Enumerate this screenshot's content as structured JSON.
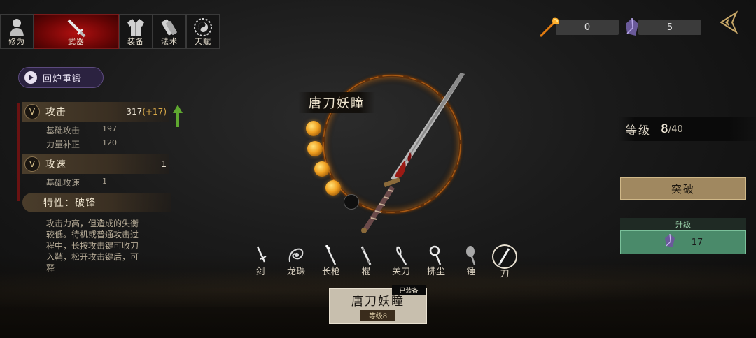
{
  "tabs": [
    {
      "label": "修为",
      "icon": "bust-icon"
    },
    {
      "label": "武器",
      "icon": "sword-icon"
    },
    {
      "label": "装备",
      "icon": "robe-icon"
    },
    {
      "label": "法术",
      "icon": "scroll-icon"
    },
    {
      "label": "天赋",
      "icon": "taiji-icon"
    }
  ],
  "currencies": [
    {
      "icon": "torch-feather-icon",
      "value": "0"
    },
    {
      "icon": "purple-crystal-icon",
      "value": "5"
    }
  ],
  "left_panel": {
    "recast_label": "回炉重锻",
    "stats": [
      {
        "name": "攻击",
        "value": "317",
        "bonus": "(+17)",
        "subs": [
          {
            "name": "基础攻击",
            "value": "197"
          },
          {
            "name": "力量补正",
            "value": "120"
          }
        ]
      },
      {
        "name": "攻速",
        "value": "1",
        "subs": [
          {
            "name": "基础攻速",
            "value": "1"
          }
        ]
      }
    ],
    "trait_label": "特性：破锋",
    "trait_desc": "攻击力高，但造成的失衡较低。待机或普通攻击过程中，长按攻击键可收刀入鞘，松开攻击键后，可释"
  },
  "weapon": {
    "name": "唐刀妖瞳",
    "orbs_filled": 4,
    "orbs_total": 5
  },
  "weapon_types": [
    {
      "label": "剑",
      "icon": "sword-type-icon"
    },
    {
      "label": "龙珠",
      "icon": "dragon-orb-icon"
    },
    {
      "label": "长枪",
      "icon": "spear-icon"
    },
    {
      "label": "棍",
      "icon": "staff-icon"
    },
    {
      "label": "关刀",
      "icon": "guandao-icon"
    },
    {
      "label": "拂尘",
      "icon": "whisk-icon"
    },
    {
      "label": "锤",
      "icon": "hammer-icon"
    },
    {
      "label": "刀",
      "icon": "blade-icon",
      "selected": true
    }
  ],
  "right_panel": {
    "level_label": "等级",
    "level": "8",
    "level_max": "/40",
    "breakthrough_label": "突破",
    "upgrade_header": "升级",
    "upgrade_cost": "17"
  },
  "equipped": {
    "tag": "已装备",
    "name": "唐刀妖瞳",
    "level_label": "等级8"
  },
  "colors": {
    "active_tab": "#8a0808",
    "accent_gold": "#d8a848",
    "upgrade_green": "#4a8a6a",
    "breakthrough_tan": "#a08860"
  }
}
